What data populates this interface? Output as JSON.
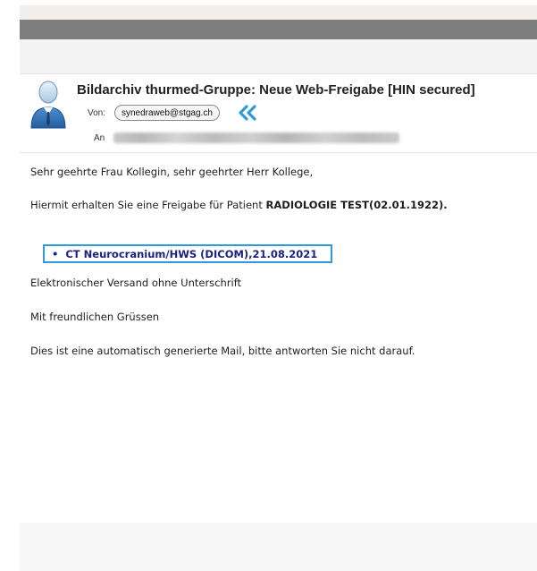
{
  "email": {
    "subject": "Bildarchiv thurmed-Gruppe: Neue Web-Freigabe [HIN secured]",
    "from_label": "Von:",
    "from_address": "synedraweb@stgag.ch",
    "to_label": "An"
  },
  "body": {
    "greeting": "Sehr geehrte Frau Kollegin, sehr geehrter Herr Kollege,",
    "intro_prefix": "Hiermit erhalten Sie eine Freigabe für Patient ",
    "patient": "RADIOLOGIE TEST(02.01.1922).",
    "attachment_bullet": "•",
    "attachment_link": "CT Neurocranium/HWS (DICOM),21.08.2021",
    "line_signature": "Elektronischer Versand ohne Unterschrift",
    "line_closing": "Mit freundlichen Grüssen",
    "line_auto": "Dies ist eine automatisch generierte Mail, bitte antworten Sie nicht darauf."
  },
  "colors": {
    "link": "#1a237e",
    "highlight_border": "#2f9bd6",
    "reply_icon": "#2f9bd6"
  },
  "icons": {
    "avatar": "user-avatar-icon",
    "reply": "double-chevron-left-icon"
  }
}
